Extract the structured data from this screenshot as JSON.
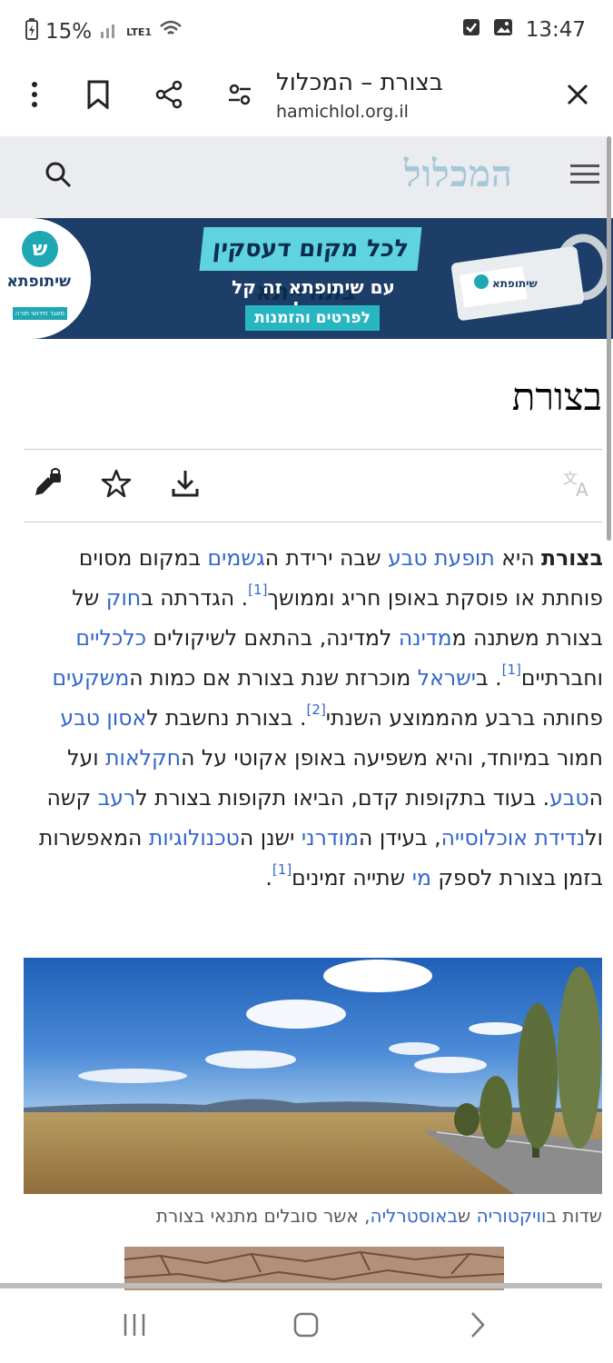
{
  "status_bar": {
    "battery": "15%",
    "network": "LTE1",
    "time": "13:47"
  },
  "toolbar": {
    "title": "בצורת – המכלול",
    "url": "hamichlol.org.il"
  },
  "site": {
    "logo": "המכלול"
  },
  "banner": {
    "brand": "שיתופתא",
    "sub": "מאגר חידושי תורה",
    "headline": "לכל מקום דעסקין בתורייתא",
    "line2": "עם שיתופתא זה קל יותר!",
    "cta": "לפרטים והזמנות >>"
  },
  "article": {
    "title": "בצורת",
    "paragraph": [
      {
        "t": "b",
        "v": "בצורת"
      },
      {
        "t": "text",
        "v": " היא "
      },
      {
        "t": "link",
        "v": "תופעת טבע"
      },
      {
        "t": "text",
        "v": " שבה ירידת ה"
      },
      {
        "t": "link",
        "v": "גשמים"
      },
      {
        "t": "text",
        "v": " במקום מסוים פוחתת או פוסקת באופן חריג וממושך"
      },
      {
        "t": "sup",
        "v": "[1]"
      },
      {
        "t": "text",
        "v": ". הגדרתה ב"
      },
      {
        "t": "link",
        "v": "חוק"
      },
      {
        "t": "text",
        "v": " של בצורת משתנה מ"
      },
      {
        "t": "link",
        "v": "מדינה"
      },
      {
        "t": "text",
        "v": " למדינה, בהתאם לשיקולים "
      },
      {
        "t": "link",
        "v": "כלכליים"
      },
      {
        "t": "text",
        "v": " וחברתיים"
      },
      {
        "t": "sup",
        "v": "[1]"
      },
      {
        "t": "text",
        "v": ". ב"
      },
      {
        "t": "link",
        "v": "ישראל"
      },
      {
        "t": "text",
        "v": " מוכרזת שנת בצורת אם כמות ה"
      },
      {
        "t": "link",
        "v": "משקעים"
      },
      {
        "t": "text",
        "v": " פחותה ברבע מהממוצע השנתי"
      },
      {
        "t": "sup",
        "v": "[2]"
      },
      {
        "t": "text",
        "v": ". בצורת נחשבת ל"
      },
      {
        "t": "link",
        "v": "אסון טבע"
      },
      {
        "t": "text",
        "v": " חמור במיוחד, והיא משפיעה באופן אקוטי על ה"
      },
      {
        "t": "link",
        "v": "חקלאות"
      },
      {
        "t": "text",
        "v": " ועל ה"
      },
      {
        "t": "link",
        "v": "טבע"
      },
      {
        "t": "text",
        "v": ". בעוד בתקופות קדם, הביאו תקופות בצורת ל"
      },
      {
        "t": "link",
        "v": "רעב"
      },
      {
        "t": "text",
        "v": " קשה ול"
      },
      {
        "t": "link",
        "v": "נדידת אוכלוסייה"
      },
      {
        "t": "text",
        "v": ", בעידן ה"
      },
      {
        "t": "link",
        "v": "מודרני"
      },
      {
        "t": "text",
        "v": " ישנן ה"
      },
      {
        "t": "link",
        "v": "טכנולוגיות"
      },
      {
        "t": "text",
        "v": " המאפשרות בזמן בצורת לספק "
      },
      {
        "t": "link",
        "v": "מי"
      },
      {
        "t": "text",
        "v": " שתייה זמינים"
      },
      {
        "t": "sup",
        "v": "[1]"
      },
      {
        "t": "text",
        "v": "."
      }
    ],
    "caption": [
      {
        "t": "text",
        "v": "שדות ב"
      },
      {
        "t": "link",
        "v": "וויקטוריה"
      },
      {
        "t": "text",
        "v": " ש"
      },
      {
        "t": "link",
        "v": "באוסטרליה"
      },
      {
        "t": "text",
        "v": ", אשר סובלים מתנאי בצורת"
      }
    ]
  },
  "icons": [
    "battery-icon",
    "signal-icon",
    "wifi-icon",
    "check-icon",
    "image-icon",
    "more-icon",
    "bookmark-icon",
    "share-icon",
    "tune-icon",
    "close-icon",
    "search-icon",
    "menu-icon",
    "lock-edit-icon",
    "star-icon",
    "download-icon",
    "translate-icon"
  ]
}
